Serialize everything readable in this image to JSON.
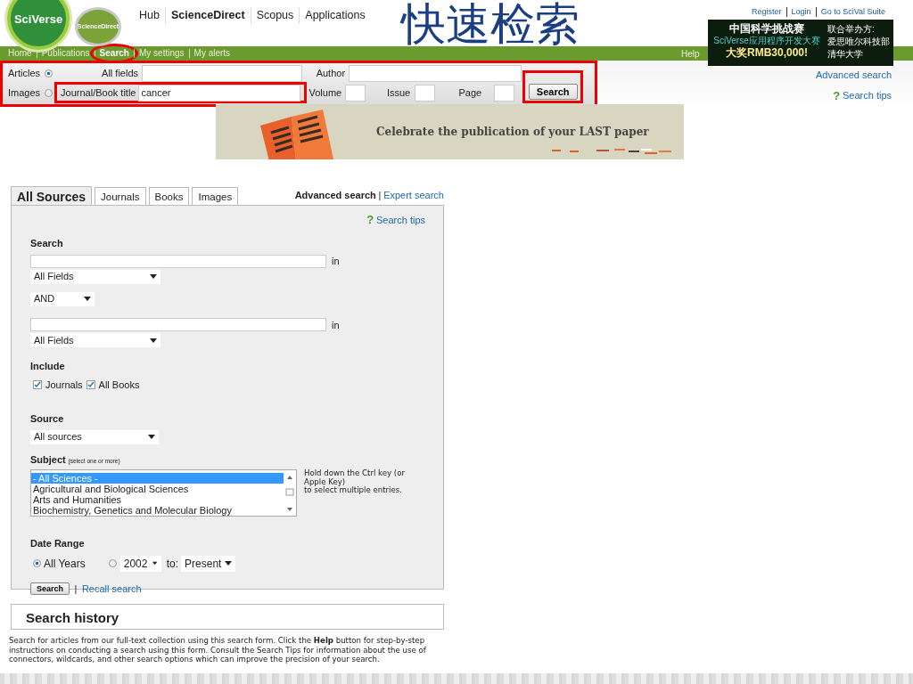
{
  "slide_title": "快速检索",
  "logo": {
    "brand": "SciVerse",
    "product": "ScienceDirect"
  },
  "top_nav": [
    {
      "label": "Hub",
      "selected": false
    },
    {
      "label": "ScienceDirect",
      "selected": true
    },
    {
      "label": "Scopus",
      "selected": false
    },
    {
      "label": "Applications",
      "selected": false
    }
  ],
  "account_links": [
    "Register",
    "Login",
    "Go to SciVal Suite"
  ],
  "promo_ad": {
    "headline": "中国科学挑战赛",
    "subline": "SciVerse应用程序开发大赛",
    "prize": "大奖RMB30,000!",
    "organizer_label": "联合举办方:",
    "organizers": [
      "爱思唯尔科技部",
      "清华大学"
    ]
  },
  "menu": [
    {
      "label": "Home",
      "selected": false,
      "highlighted": false
    },
    {
      "label": "Publications",
      "selected": false,
      "highlighted": false
    },
    {
      "label": "Search",
      "selected": true,
      "highlighted": true
    },
    {
      "label": "My settings",
      "selected": false,
      "highlighted": false
    },
    {
      "label": "My alerts",
      "selected": false,
      "highlighted": false
    }
  ],
  "help": "Help",
  "quick_search": {
    "types": [
      {
        "label": "Articles",
        "selected": true
      },
      {
        "label": "Images",
        "selected": false
      }
    ],
    "all_fields": {
      "label": "All fields"
    },
    "author": {
      "label": "Author"
    },
    "journal": {
      "label": "Journal/Book title",
      "value": "cancer"
    },
    "volume": {
      "label": "Volume"
    },
    "issue": {
      "label": "Issue"
    },
    "page": {
      "label": "Page"
    },
    "button": "Search",
    "advanced_link": "Advanced search",
    "tips_mark": "?",
    "tips_link": "Search tips"
  },
  "banner": {
    "text": "Celebrate the publication of your LAST paper"
  },
  "advanced": {
    "tabs": [
      {
        "label": "All Sources",
        "selected": true
      },
      {
        "label": "Journals",
        "selected": false
      },
      {
        "label": "Books",
        "selected": false
      },
      {
        "label": "Images",
        "selected": false
      }
    ],
    "modes": [
      {
        "label": "Advanced search",
        "selected": true
      },
      {
        "label": "Expert search",
        "selected": false
      }
    ],
    "mode_separator": "|",
    "tips_mark": "?",
    "tips_link": "Search tips",
    "search_label": "Search",
    "terms": [
      {
        "in": "in",
        "field": "All Fields"
      },
      {
        "in": "in",
        "field": "All Fields"
      }
    ],
    "connector": "AND",
    "include_label": "Include",
    "include": [
      {
        "label": "Journals",
        "checked": true
      },
      {
        "label": "All Books",
        "checked": true
      }
    ],
    "source_label": "Source",
    "source": "All sources",
    "subject_label": "Subject",
    "subject_hint": "(select one or more)",
    "subjects": [
      {
        "label": "- All Sciences -",
        "selected": true
      },
      {
        "label": "Agricultural and Biological Sciences",
        "selected": false
      },
      {
        "label": "Arts and Humanities",
        "selected": false
      },
      {
        "label": "Biochemistry, Genetics and Molecular Biology",
        "selected": false
      }
    ],
    "subject_note": "Hold down the Ctrl key (or\nApple Key)\nto select multiple entries.",
    "date_label": "Date Range",
    "date_options": [
      {
        "label": "All Years",
        "selected": true
      },
      {
        "selected": false
      }
    ],
    "from_year": "2002",
    "to_label": "to:",
    "to_year": "Present",
    "button": "Search",
    "button_separator": "|",
    "recall_link": "Recall search"
  },
  "history": {
    "title": "Search history",
    "description": "Search for articles from our full-text collection using this search form. Click the **Help** button for step-by-step instructions on conducting a search using this form. Consult the Search Tips for information about the use of connectors, wildcards, and other search options which can improve the precision of your search."
  }
}
